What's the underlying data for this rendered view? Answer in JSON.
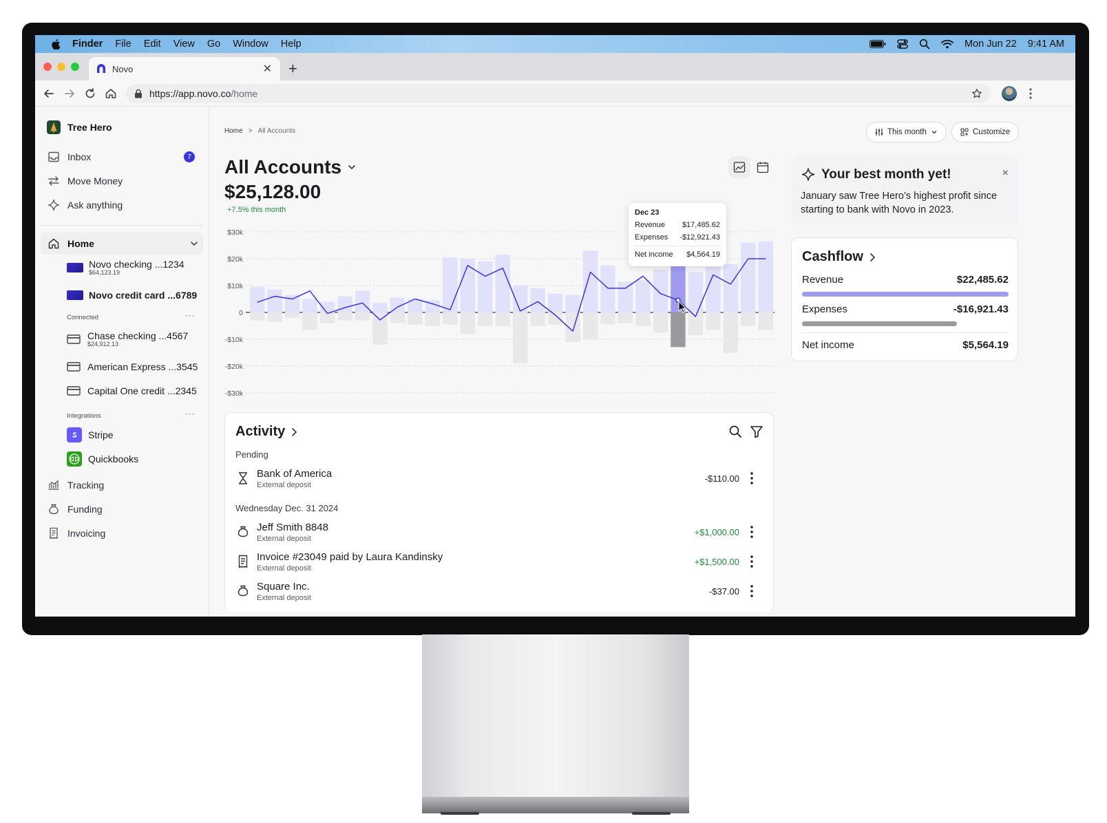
{
  "menubar": {
    "app": "Finder",
    "items": [
      "File",
      "Edit",
      "View",
      "Go",
      "Window",
      "Help"
    ],
    "date": "Mon Jun 22",
    "time": "9:41 AM"
  },
  "browser": {
    "tab_title": "Novo",
    "url_host": "https://app.novo.co",
    "url_path": "/home"
  },
  "sidebar": {
    "org_name": "Tree Hero",
    "inbox_label": "Inbox",
    "inbox_count": "7",
    "move_money": "Move Money",
    "ask_anything": "Ask anything",
    "home": "Home",
    "accounts": [
      {
        "name": "Novo checking ...1234",
        "balance": "$64,123.19"
      },
      {
        "name": "Novo credit card ...6789",
        "balance": ""
      }
    ],
    "connected_label": "Connected",
    "connected": [
      {
        "name": "Chase checking ...4567",
        "balance": "$24,912.13"
      },
      {
        "name": "American Express ...3545",
        "balance": ""
      },
      {
        "name": "Capital One credit ...2345",
        "balance": ""
      }
    ],
    "integrations_label": "Integrations",
    "integrations": [
      "Stripe",
      "Quickbooks"
    ],
    "more_glyph": "···",
    "tracking": "Tracking",
    "funding": "Funding",
    "invoicing": "Invoicing"
  },
  "main": {
    "breadcrumb_home": "Home",
    "breadcrumb_sep": ">",
    "breadcrumb_current": "All Accounts",
    "period_label": "This month",
    "customize_label": "Customize",
    "title": "All Accounts",
    "balance": "$25,128.00",
    "change": "+7.5% this month"
  },
  "chart_data": {
    "type": "bar",
    "yticks": [
      "$30k",
      "$20k",
      "$10k",
      "0",
      "-$10k",
      "-$20k",
      "-$30k"
    ],
    "ylim": [
      -30000,
      30000
    ],
    "revenue": [
      9500,
      8500,
      6500,
      5000,
      4000,
      6000,
      8000,
      3500,
      5500,
      5000,
      4500,
      20500,
      20000,
      19000,
      21500,
      10000,
      9000,
      7000,
      6500,
      23000,
      17500,
      11500,
      12000,
      16000,
      17485.62,
      15000,
      17000,
      18000,
      26000,
      26500
    ],
    "expenses": [
      -3000,
      -3500,
      -2000,
      -6500,
      -4000,
      -3000,
      -3000,
      -12000,
      -4000,
      -4500,
      -5000,
      -4500,
      -8000,
      -5000,
      -5000,
      -19000,
      -5000,
      -4500,
      -11000,
      -10000,
      -4500,
      -4000,
      -5000,
      -7500,
      -12921.43,
      -8500,
      -6500,
      -15000,
      -5000,
      -6500
    ],
    "net_income": [
      3800,
      6000,
      5000,
      8000,
      -400,
      1800,
      3500,
      -2800,
      2000,
      5000,
      3200,
      1000,
      17500,
      13500,
      16500,
      500,
      4000,
      -1000,
      -7000,
      15000,
      9000,
      9000,
      13500,
      7000,
      4564.19,
      -1500,
      14000,
      10500,
      20000,
      20000
    ],
    "highlight_index": 24,
    "tooltip": {
      "date": "Dec 23",
      "revenue_label": "Revenue",
      "revenue": "$17,485.62",
      "expenses_label": "Expenses",
      "expenses": "-$12,921.43",
      "net_label": "Net income",
      "net": "$4,564.19"
    },
    "colors": {
      "revenue": "#e2e1fb",
      "expenses": "#e8e8ea",
      "highlight_rev": "#9f9cf0",
      "highlight_exp": "#9a9a9e",
      "line": "#3b35d6"
    }
  },
  "activity": {
    "title": "Activity",
    "pending_label": "Pending",
    "pending": {
      "name": "Bank of America",
      "sub": "External deposit",
      "amount": "-$110.00"
    },
    "date_label": "Wednesday Dec. 31 2024",
    "items": [
      {
        "name": "Jeff Smith 8848",
        "sub": "External deposit",
        "amount": "+$1,000.00"
      },
      {
        "name": "Invoice #23049 paid by Laura Kandinsky",
        "sub": "External deposit",
        "amount": "+$1,500.00"
      },
      {
        "name": "Square Inc.",
        "sub": "External deposit",
        "amount": "-$37.00"
      }
    ]
  },
  "best_month": {
    "title": "Your best month yet!",
    "body": "January saw Tree Hero’s highest profit since starting to bank with Novo in 2023.",
    "close": "×"
  },
  "cashflow": {
    "title": "Cashflow",
    "revenue_label": "Revenue",
    "revenue": "$22,485.62",
    "expenses_label": "Expenses",
    "expenses": "-$16,921.43",
    "net_label": "Net income",
    "net": "$5,564.19",
    "expenses_fraction": 0.75
  }
}
